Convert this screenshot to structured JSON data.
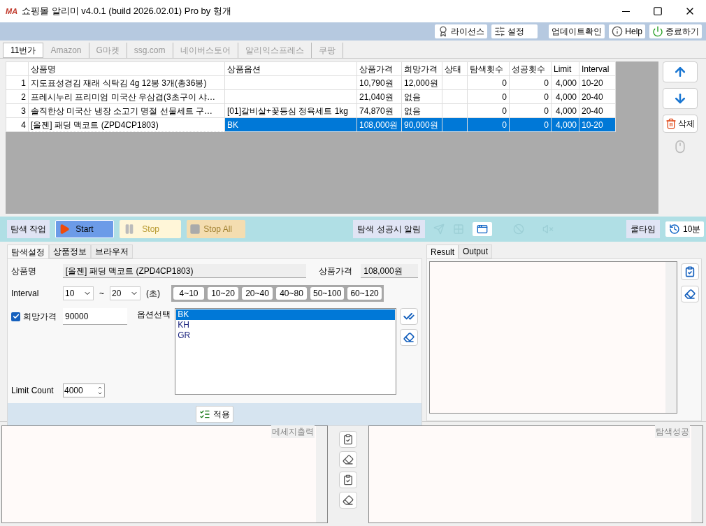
{
  "window": {
    "title": "쇼핑몰 알리미 v4.0.1 (build 2026.02.01) Pro by 헝개",
    "logo": "MA"
  },
  "toolbar": {
    "buttons": [
      {
        "kind": "license",
        "label": "라이선스"
      },
      {
        "kind": "settings",
        "label": "설정"
      },
      {
        "kind": "update",
        "label": "업데이트확인"
      },
      {
        "kind": "help",
        "label": "Help"
      },
      {
        "kind": "quit",
        "label": "종료하기"
      }
    ]
  },
  "site_tabs": [
    {
      "label": "11번가",
      "selected": true
    },
    {
      "label": "Amazon",
      "selected": false
    },
    {
      "label": "G마켓",
      "selected": false
    },
    {
      "label": "ssg.com",
      "selected": false
    },
    {
      "label": "네이버스토어",
      "selected": false
    },
    {
      "label": "알리익스프레스",
      "selected": false
    },
    {
      "label": "쿠팡",
      "selected": false
    }
  ],
  "table": {
    "columns": [
      "상품명",
      "상품옵션",
      "상품가격",
      "희망가격",
      "상태",
      "탐색횟수",
      "성공횟수",
      "Limit",
      "Interval"
    ],
    "rows": [
      {
        "number": "1",
        "cells": [
          "지도표성경김 재래 식탁김 4g 12봉 3개(총36봉)",
          "",
          "10,790원",
          "12,000원",
          "",
          "0",
          "0",
          "4,000",
          "10-20"
        ],
        "selected": false
      },
      {
        "number": "2",
        "cells": [
          "프레시누리 프리미엄 미국산 우삼겹(3초구이 샤…",
          "",
          "21,040원",
          "없음",
          "",
          "0",
          "0",
          "4,000",
          "20-40"
        ],
        "selected": false
      },
      {
        "number": "3",
        "cells": [
          "솔직한상  미국산 냉장 소고기 명절 선물세트 구…",
          "[01]갈비살+꽃등심 정육세트 1kg",
          "74,870원",
          "없음",
          "",
          "0",
          "0",
          "4,000",
          "20-40"
        ],
        "selected": false
      },
      {
        "number": "4",
        "cells": [
          "[올젠] 패딩 맥코트 (ZPD4CP1803)",
          "BK",
          "108,000원",
          "90,000원",
          "",
          "0",
          "0",
          "4,000",
          "10-20"
        ],
        "selected": true
      }
    ]
  },
  "side_buttons": {
    "delete": "삭제"
  },
  "controls": {
    "section_label": "탐색 작업",
    "start": "Start",
    "stop": "Stop",
    "stop_all": "Stop All",
    "alert_label": "탐색 성공시 알림",
    "cooltime_label": "쿨타임",
    "cooltime_value": "10분"
  },
  "settings": {
    "tabs": [
      {
        "label": "탐색설정",
        "selected": true
      },
      {
        "label": "상품정보",
        "selected": false
      },
      {
        "label": "브라우저",
        "selected": false
      }
    ],
    "product_name_label": "상품명",
    "product_name": "[올젠] 패딩 맥코트 (ZPD4CP1803)",
    "price_label": "상품가격",
    "price": "108,000원",
    "interval_label": "Interval",
    "interval_from": "10",
    "interval_sep": "~",
    "interval_to": "20",
    "interval_unit": "(초)",
    "presets": [
      "4~10",
      "10~20",
      "20~40",
      "40~80",
      "50~100",
      "60~120"
    ],
    "wish_price": {
      "label": "희망가격",
      "checked": true,
      "value": "90000"
    },
    "option_label": "옵션선택",
    "options": [
      {
        "label": "BK",
        "selected": true
      },
      {
        "label": "KH",
        "selected": false
      },
      {
        "label": "GR",
        "selected": false
      }
    ],
    "limit_label": "Limit Count",
    "limit_value": "4000",
    "apply": "적용"
  },
  "result": {
    "tabs": [
      {
        "label": "Result",
        "selected": true
      },
      {
        "label": "Output",
        "selected": false
      }
    ]
  },
  "bottom": {
    "message_label": "메세지출력",
    "success_label": "탐색성공"
  }
}
